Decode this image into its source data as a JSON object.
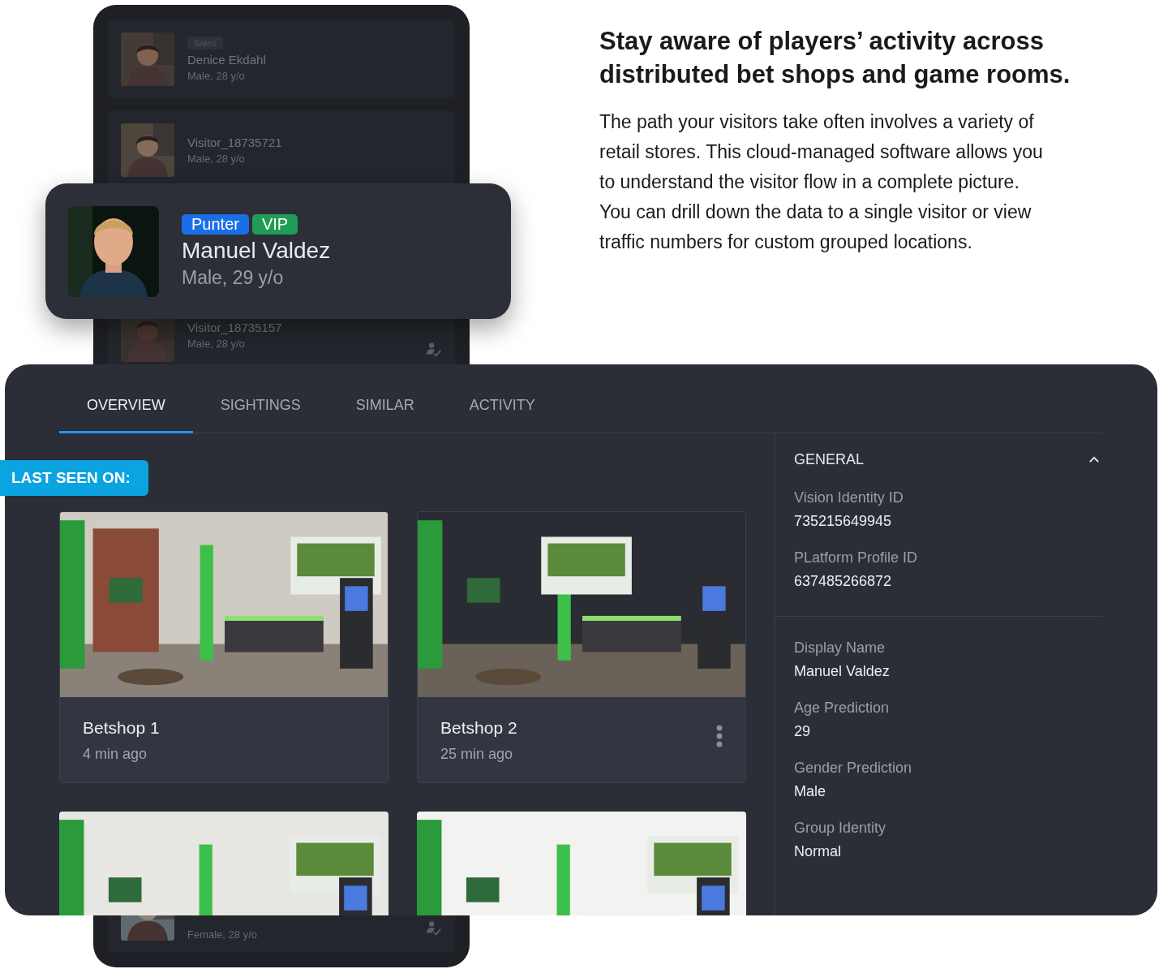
{
  "headline": "Stay aware of players’ activity across distributed bet shops and game rooms.",
  "description": "The path your visitors take often involves a variety of retail stores. This cloud-managed software allows you to understand the visitor flow in a complete picture. You can drill down the data to a single visitor or view traffic numbers for custom grouped locations.",
  "visitor_list": [
    {
      "tag": "Sales",
      "name": "Denice Ekdahl",
      "meta": "Male, 28 y/o",
      "verified": false
    },
    {
      "name": "Visitor_18735721",
      "meta": "Male, 28 y/o",
      "verified": false
    },
    {
      "name": "Visitor_18735157",
      "meta": "Male, 28 y/o",
      "verified": true
    },
    {
      "meta": "Female, 28 y/o",
      "verified": true
    }
  ],
  "profile_card": {
    "tags": [
      {
        "label": "Punter",
        "color": "#1a6fe8"
      },
      {
        "label": "VIP",
        "color": "#1f9d55"
      }
    ],
    "name": "Manuel Valdez",
    "meta": "Male, 29 y/o"
  },
  "tabs": [
    {
      "label": "OVERVIEW",
      "selected": true
    },
    {
      "label": "SIGHTINGS",
      "selected": false
    },
    {
      "label": "SIMILAR",
      "selected": false
    },
    {
      "label": "ACTIVITY",
      "selected": false
    }
  ],
  "last_seen_label": "LAST SEEN ON:",
  "locations": [
    {
      "name": "Betshop 1",
      "time": "4 min ago",
      "menu": false
    },
    {
      "name": "Betshop 2",
      "time": "25 min ago",
      "menu": true
    },
    {
      "kind": "picture"
    },
    {
      "kind": "picture"
    }
  ],
  "general": {
    "title": "GENERAL",
    "expanded": true,
    "groups": [
      [
        {
          "label": "Vision Identity ID",
          "value": "735215649945"
        },
        {
          "label": "PLatform Profile ID",
          "value": "637485266872"
        }
      ],
      [
        {
          "label": "Display Name",
          "value": "Manuel Valdez"
        },
        {
          "label": "Age Prediction",
          "value": "29"
        },
        {
          "label": "Gender Prediction",
          "value": "Male"
        },
        {
          "label": "Group Identity",
          "value": "Normal"
        }
      ]
    ]
  }
}
